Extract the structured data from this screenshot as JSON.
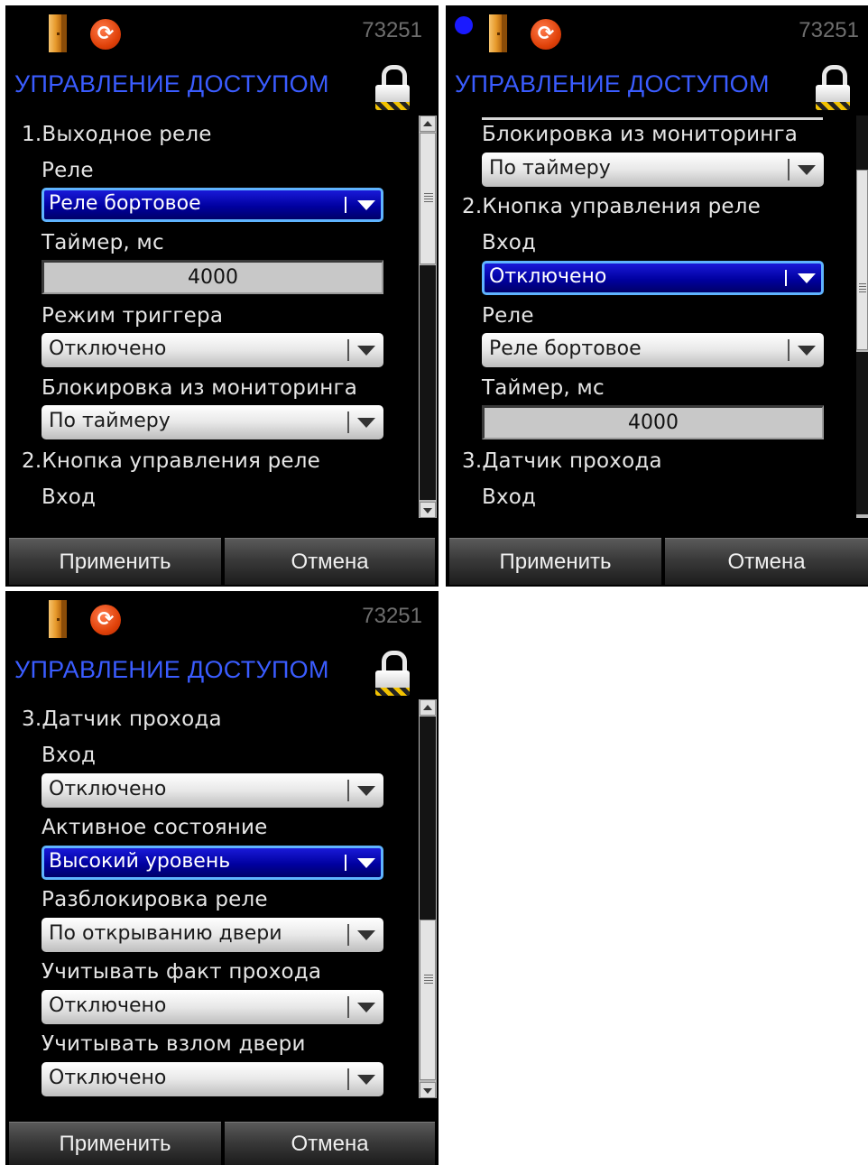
{
  "common": {
    "device_id": "73251",
    "title": "УПРАВЛЕНИЕ ДОСТУПОМ",
    "apply_label": "Применить",
    "cancel_label": "Отмена",
    "sync_glyph": "⟳"
  },
  "screen1": {
    "sections": [
      {
        "header": "1.Выходное реле"
      },
      {
        "header": "2.Кнопка управления реле"
      }
    ],
    "fields": {
      "rele_label": "Реле",
      "rele_value": "Реле бортовое",
      "timer_label": "Таймер, мс",
      "timer_value": "4000",
      "trigger_label": "Режим триггера",
      "trigger_value": "Отключено",
      "block_label": "Блокировка из мониторинга",
      "block_value": "По таймеру",
      "input_label": "Вход"
    }
  },
  "screen2": {
    "sections": [
      {
        "header": "2.Кнопка управления реле"
      },
      {
        "header": "3.Датчик прохода"
      }
    ],
    "fields": {
      "block_label": "Блокировка из мониторинга",
      "block_value": "По таймеру",
      "input_label": "Вход",
      "input_value": "Отключено",
      "rele_label": "Реле",
      "rele_value": "Реле бортовое",
      "timer_label": "Таймер, мс",
      "timer_value": "4000",
      "input2_label": "Вход"
    }
  },
  "screen3": {
    "sections": [
      {
        "header": "3.Датчик прохода"
      }
    ],
    "fields": {
      "input_label": "Вход",
      "input_value": "Отключено",
      "active_label": "Активное состояние",
      "active_value": "Высокий уровень",
      "unlock_label": "Разблокировка реле",
      "unlock_value": "По открыванию двери",
      "pass_label": "Учитывать факт прохода",
      "pass_value": "Отключено",
      "breakin_label": "Учитывать взлом двери",
      "breakin_value": "Отключено"
    }
  },
  "icons": {
    "door": "door-icon",
    "sync": "sync-icon",
    "lock": "lock-icon",
    "status_dot": "status-dot-icon",
    "dropdown_arrow": "chevron-down-icon"
  },
  "colors": {
    "title": "#3a5cff",
    "focus_fill": "#0000a0",
    "focus_border": "#5fb4ff",
    "status_dot": "#1a1aff",
    "sync": "#e0420a"
  }
}
